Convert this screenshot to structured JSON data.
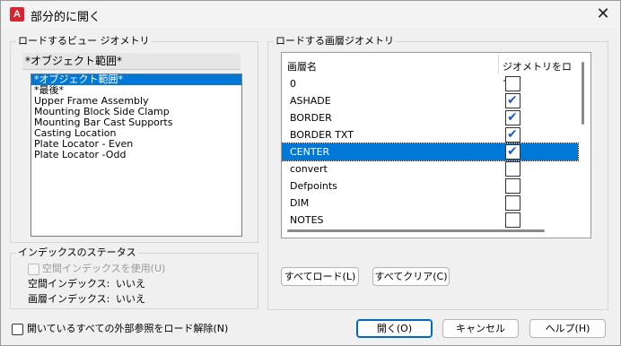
{
  "window": {
    "title": "部分的に開く",
    "app_icon_letter": "A",
    "close_glyph": "✕"
  },
  "view_group": {
    "legend": "ロードするビュー ジオメトリ",
    "header": "*オブジェクト範囲*",
    "items": [
      "*オブジェクト範囲*",
      "*最後*",
      "Upper Frame Assembly",
      "Mounting Block Side Clamp",
      "Mounting Bar Cast Supports",
      "Casting Location",
      "Plate Locator - Even",
      "Plate Locator -Odd"
    ],
    "selected_index": 0
  },
  "layer_group": {
    "legend": "ロードする画層ジオメトリ",
    "col_name": "画層名",
    "col_load": "ジオメトリをロード",
    "rows": [
      {
        "name": "0",
        "checked": false
      },
      {
        "name": "ASHADE",
        "checked": true
      },
      {
        "name": "BORDER",
        "checked": true
      },
      {
        "name": "BORDER TXT",
        "checked": true
      },
      {
        "name": "CENTER",
        "checked": true
      },
      {
        "name": "convert",
        "checked": false
      },
      {
        "name": "Defpoints",
        "checked": false
      },
      {
        "name": "DIM",
        "checked": false
      },
      {
        "name": "NOTES",
        "checked": false
      }
    ],
    "selected_row": 4,
    "load_all_label": "すべてロード(L)",
    "clear_all_label": "すべてクリア(C)"
  },
  "index_group": {
    "legend": "インデックスのステータス",
    "use_spatial_label": "空間インデックスを使用(U)",
    "spatial_label": "空間インデックス:",
    "spatial_value": "いいえ",
    "layer_label": "画層インデックス:",
    "layer_value": "いいえ"
  },
  "footer": {
    "unload_xref_label": "開いているすべての外部参照をロード解除(N)",
    "open_label": "開く(O)",
    "cancel_label": "キャンセル",
    "help_label": "ヘルプ(H)"
  }
}
